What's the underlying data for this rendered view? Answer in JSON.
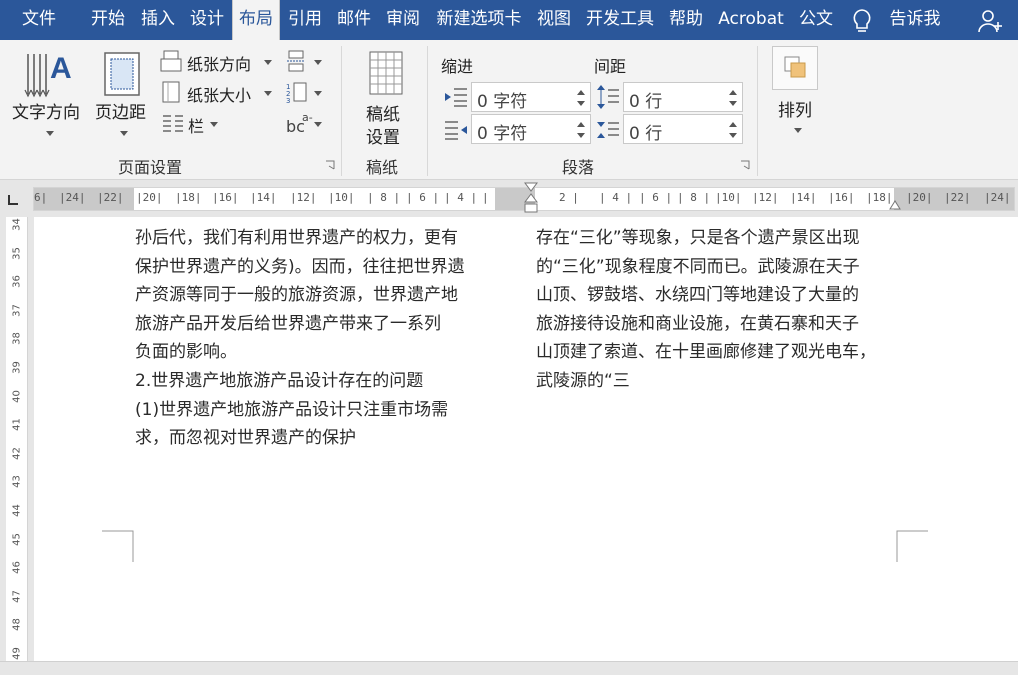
{
  "tabs": [
    "文件",
    "开始",
    "插入",
    "设计",
    "布局",
    "引用",
    "邮件",
    "审阅",
    "新建选项卡",
    "视图",
    "开发工具",
    "帮助",
    "Acrobat",
    "公文"
  ],
  "active_tab": "布局",
  "tell_me": "告诉我",
  "ribbon": {
    "page_setup": {
      "text_direction": "文字方向",
      "margins": "页边距",
      "orientation": "纸张方向",
      "size": "纸张大小",
      "columns": "栏",
      "hyphenation_icon": "bc",
      "group_label": "页面设置"
    },
    "draft": {
      "setup_line1": "稿纸",
      "setup_line2": "设置",
      "group_label": "稿纸"
    },
    "paragraph": {
      "indent_label": "缩进",
      "spacing_label": "间距",
      "indent_left": "0 字符",
      "indent_right": "0 字符",
      "spacing_before": "0 行",
      "spacing_after": "0 行",
      "group_label": "段落"
    },
    "arrange": {
      "label": "排列"
    }
  },
  "ruler": {
    "ticks": [
      "6|",
      "|24|",
      "|22|",
      "|20|",
      "|18|",
      "|16|",
      "|14|",
      "|12|",
      "|10|",
      "| 8 |",
      "| 6 |",
      "| 4 |",
      "|",
      "2 |",
      "| 4 |",
      "| 6 |",
      "| 8 |",
      "|10|",
      "|12|",
      "|14|",
      "|16|",
      "|18|",
      "|20|",
      "|22|",
      "|24|"
    ]
  },
  "vruler": {
    "numbers": [
      "34",
      "35",
      "36",
      "37",
      "38",
      "39",
      "40",
      "41",
      "42",
      "43",
      "44",
      "45",
      "46",
      "47",
      "48",
      "49"
    ]
  },
  "document": {
    "left_column": [
      "孙后代，我们有利用世界遗产的权力，更有",
      "保护世界遗产的义务)。因而，往往把世界遗",
      "产资源等同于一般的旅游资源，世界遗产地",
      "旅游产品开发后给世界遗产带来了一系列",
      "负面的影响。",
      "2.世界遗产地旅游产品设计存在的问题",
      "(1)世界遗产地旅游产品设计只注重市场需",
      "求，而忽视对世界遗产的保护"
    ],
    "right_column": [
      "存在“三化”等现象，只是各个遗产景区出现",
      "的“三化”现象程度不同而已。武陵源在天子",
      "山顶、锣鼓塔、水绕四门等地建设了大量的",
      "旅游接待设施和商业设施，在黄石寨和天子",
      "山顶建了索道、在十里画廊修建了观光电车，",
      "武陵源的“三"
    ]
  },
  "colors": {
    "accent": "#2b579a",
    "ribbon_bg": "#f3f3f3",
    "page_bg": "#ffffff"
  }
}
